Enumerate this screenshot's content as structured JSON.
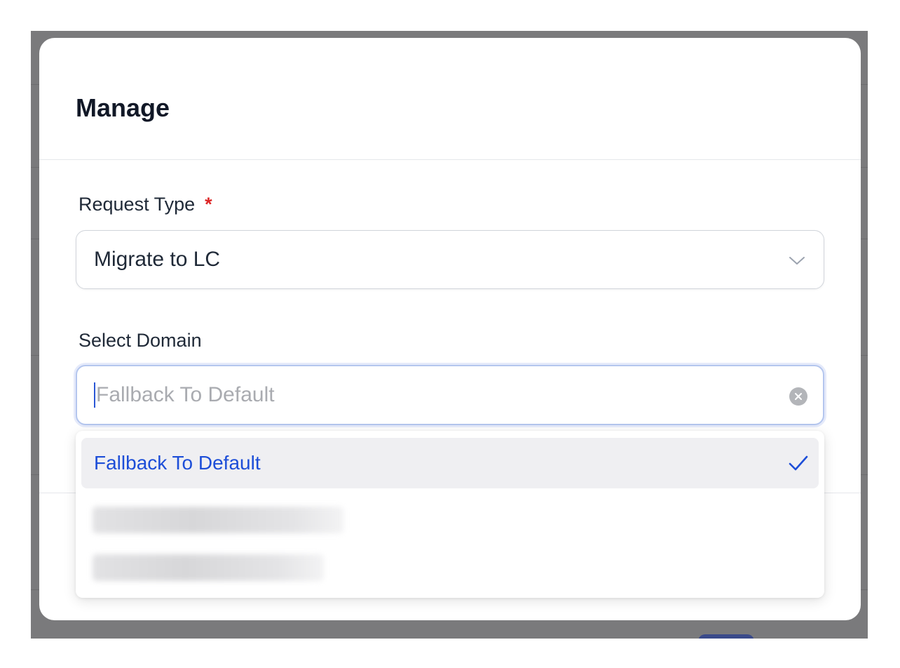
{
  "modal": {
    "title": "Manage"
  },
  "request_type": {
    "label": "Request Type",
    "required_mark": "*",
    "value": "Migrate to LC"
  },
  "domain": {
    "label": "Select Domain",
    "placeholder": "Fallback To Default",
    "options": [
      {
        "label": "Fallback To Default",
        "selected": true
      }
    ]
  },
  "icons": {
    "select_chevron": "chevron-down-icon",
    "clear": "clear-circle-icon",
    "check": "checkmark-icon"
  },
  "colors": {
    "accent": "#1d4ed8",
    "required": "#dc2626",
    "focus_border": "#b4c6ee",
    "selected_bg": "#efeff2"
  }
}
